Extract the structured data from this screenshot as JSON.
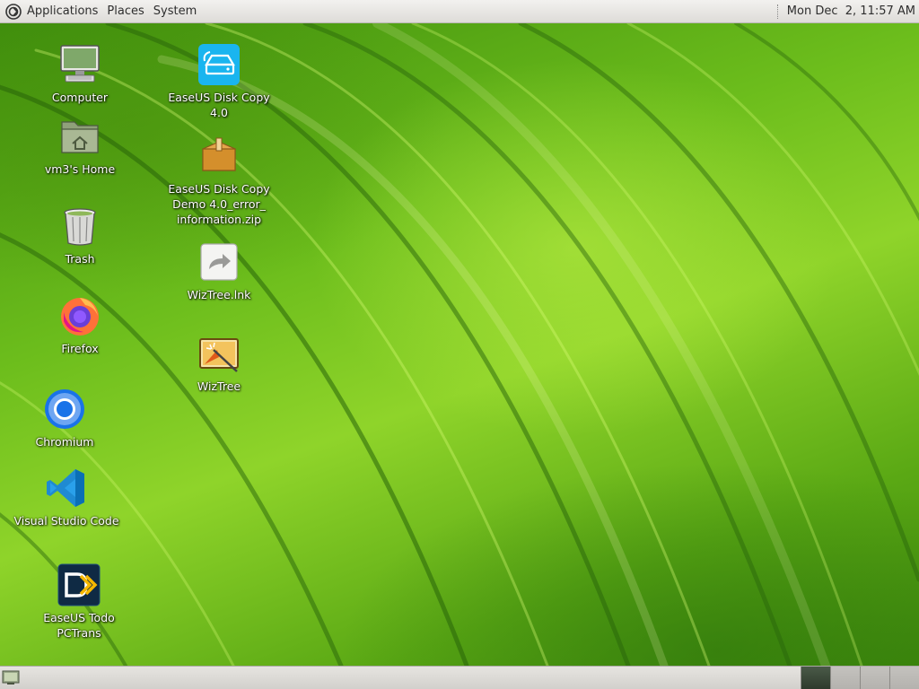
{
  "top_panel": {
    "menus": [
      "Applications",
      "Places",
      "System"
    ],
    "clock": "Mon Dec  2, 11:57 AM"
  },
  "desktop": {
    "icons": [
      {
        "label": "Computer",
        "icon": "computer-icon"
      },
      {
        "label": "vm3's Home",
        "icon": "home-folder-icon"
      },
      {
        "label": "Trash",
        "icon": "trash-icon"
      },
      {
        "label": "Firefox",
        "icon": "firefox-icon"
      },
      {
        "label": "Chromium",
        "icon": "chromium-icon"
      },
      {
        "label": "Visual Studio Code",
        "icon": "vscode-icon"
      },
      {
        "label": "EaseUS Todo PCTrans",
        "icon": "pctrans-icon"
      },
      {
        "label": "EaseUS Disk Copy 4.0",
        "icon": "disk-copy-icon"
      },
      {
        "label": "EaseUS Disk Copy\nDemo 4.0_error_\ninformation.zip",
        "icon": "zip-archive-icon"
      },
      {
        "label": "WizTree.lnk",
        "icon": "shortcut-icon"
      },
      {
        "label": "WizTree",
        "icon": "wiztree-icon"
      }
    ]
  },
  "bottom_panel": {
    "workspaces": 4,
    "active_workspace": 1
  },
  "colors": {
    "wallpaper": "#6cbd1c",
    "panel": "#e6e4e0",
    "active_workspace": "#3a4838"
  }
}
